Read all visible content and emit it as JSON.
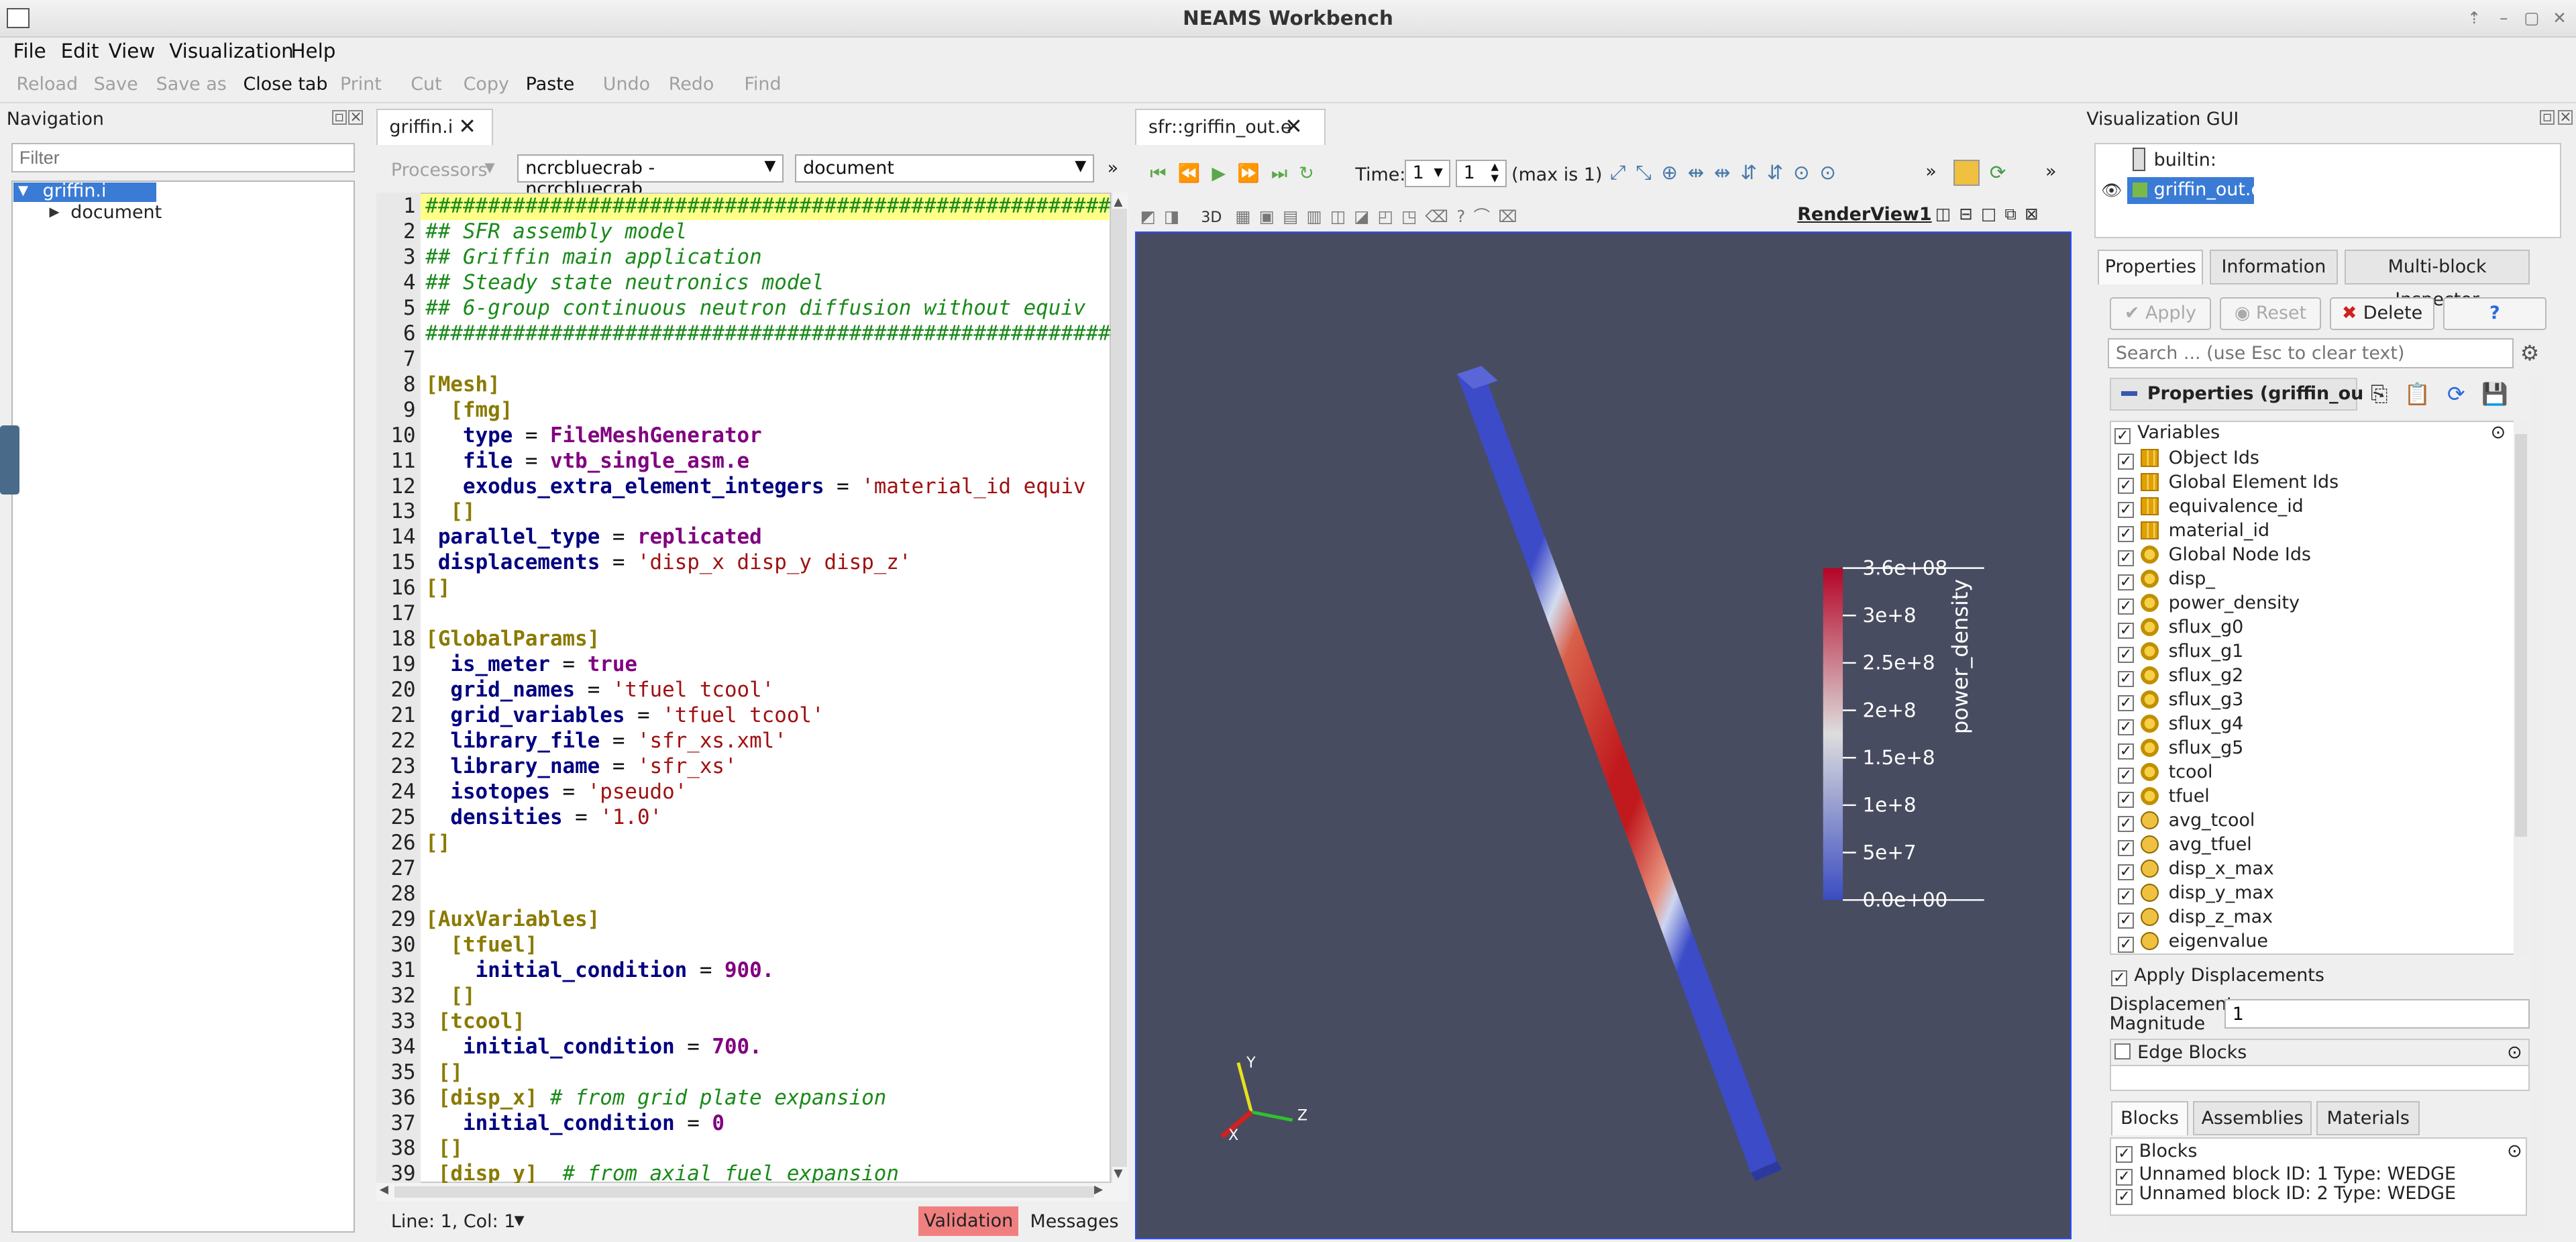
{
  "window": {
    "title": "NEAMS Workbench"
  },
  "menu": [
    "File",
    "Edit",
    "View",
    "Visualization",
    "Help"
  ],
  "toolbar": [
    {
      "label": "Reload",
      "enabled": false
    },
    {
      "label": "Save",
      "enabled": false
    },
    {
      "label": "Save as",
      "enabled": false
    },
    {
      "label": "Close tab",
      "enabled": true
    },
    {
      "label": "Print",
      "enabled": false
    },
    {
      "label": "Cut",
      "enabled": false
    },
    {
      "label": "Copy",
      "enabled": false
    },
    {
      "label": "Paste",
      "enabled": true
    },
    {
      "label": "Undo",
      "enabled": false
    },
    {
      "label": "Redo",
      "enabled": false
    },
    {
      "label": "Find",
      "enabled": false
    }
  ],
  "navigation": {
    "title": "Navigation",
    "filter_placeholder": "Filter",
    "tree": [
      {
        "label": "griffin.i",
        "selected": true
      },
      {
        "label": "document"
      }
    ]
  },
  "editor": {
    "tab_label": "griffin.i",
    "processors_label": "Processors",
    "executable": "ncrcbluecrab - ncrcbluecrab",
    "document_select": "document",
    "status": "Line: 1, Col: 1",
    "validation_label": "Validation",
    "messages_label": "Messages"
  },
  "code_lines": [
    "######################################################################",
    "## SFR assembly model",
    "## Griffin main application",
    "## Steady state neutronics model",
    "## 6-group continuous neutron diffusion without equiv",
    "######################################################################",
    "",
    "[Mesh]",
    "  [fmg]",
    "   type = FileMeshGenerator",
    "   file = vtb_single_asm.e",
    "   exodus_extra_element_integers = 'material_id equiv",
    "  []",
    " parallel_type = replicated",
    " displacements = 'disp_x disp_y disp_z'",
    "[]",
    "",
    "[GlobalParams]",
    "  is_meter = true",
    "  grid_names = 'tfuel tcool'",
    "  grid_variables = 'tfuel tcool'",
    "  library_file = 'sfr_xs.xml'",
    "  library_name = 'sfr_xs'",
    "  isotopes = 'pseudo'",
    "  densities = '1.0'",
    "[]",
    "",
    "",
    "[AuxVariables]",
    "  [tfuel]",
    "    initial_condition = 900.",
    "  []",
    " [tcool]",
    "   initial_condition = 700.",
    " []",
    " [disp_x] # from grid plate expansion",
    "   initial_condition = 0",
    " []",
    " [disp_y]  # from axial fuel expansion"
  ],
  "viewer": {
    "tab_label": "sfr::griffin_out.e",
    "time_label": "Time:",
    "time_value": "1",
    "time_index": "1",
    "time_max": "(max is 1)",
    "render_view": "RenderView1",
    "mode_3d": "3D",
    "colorbar": {
      "title": "power_density",
      "ticks": [
        "3.6e+08",
        "3e+8",
        "2.5e+8",
        "2e+8",
        "1.5e+8",
        "1e+8",
        "5e+7",
        "0.0e+00"
      ]
    },
    "axes": {
      "x": "X",
      "y": "Y",
      "z": "Z"
    }
  },
  "visgui": {
    "title": "Visualization GUI",
    "pipeline": [
      {
        "label": "builtin:"
      },
      {
        "label": "griffin_out.e",
        "selected": true
      }
    ],
    "tabs": [
      "Properties",
      "Information",
      "Multi-block Inspector"
    ],
    "apply": "Apply",
    "reset": "Reset",
    "delete": "Delete",
    "help": "?",
    "search_placeholder": "Search ... (use Esc to clear text)",
    "properties_header": "Properties (griffin_ou",
    "variables_header": "Variables",
    "variables": [
      {
        "name": "Object Ids",
        "kind": "cell"
      },
      {
        "name": "Global Element Ids",
        "kind": "cell"
      },
      {
        "name": "equivalence_id",
        "kind": "cell"
      },
      {
        "name": "material_id",
        "kind": "cell"
      },
      {
        "name": "Global Node Ids",
        "kind": "point"
      },
      {
        "name": "disp_",
        "kind": "point"
      },
      {
        "name": "power_density",
        "kind": "point"
      },
      {
        "name": "sflux_g0",
        "kind": "point"
      },
      {
        "name": "sflux_g1",
        "kind": "point"
      },
      {
        "name": "sflux_g2",
        "kind": "point"
      },
      {
        "name": "sflux_g3",
        "kind": "point"
      },
      {
        "name": "sflux_g4",
        "kind": "point"
      },
      {
        "name": "sflux_g5",
        "kind": "point"
      },
      {
        "name": "tcool",
        "kind": "point"
      },
      {
        "name": "tfuel",
        "kind": "point"
      },
      {
        "name": "avg_tcool",
        "kind": "field"
      },
      {
        "name": "avg_tfuel",
        "kind": "field"
      },
      {
        "name": "disp_x_max",
        "kind": "field"
      },
      {
        "name": "disp_y_max",
        "kind": "field"
      },
      {
        "name": "disp_z_max",
        "kind": "field"
      },
      {
        "name": "eigenvalue",
        "kind": "field"
      }
    ],
    "apply_displacements": "Apply Displacements",
    "displacement_magnitude_label": "Displacement Magnitude",
    "displacement_magnitude_value": "1",
    "edge_blocks": "Edge Blocks",
    "bottom_tabs": [
      "Blocks",
      "Assemblies",
      "Materials"
    ],
    "blocks_header": "Blocks",
    "blocks": [
      "Unnamed block ID: 1 Type: WEDGE",
      "Unnamed block ID: 2 Type: WEDGE"
    ]
  }
}
